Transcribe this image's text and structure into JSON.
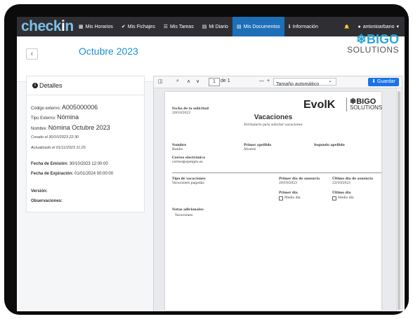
{
  "brand": {
    "logo_main": "check",
    "logo_accent": "i",
    "logo_tail": "n"
  },
  "nav": {
    "items": [
      {
        "label": "Mis Horarios",
        "icon": "calendar-icon",
        "glyph": "▦"
      },
      {
        "label": "Mis Fichajes",
        "icon": "check-icon",
        "glyph": "✔"
      },
      {
        "label": "Mis Tareas",
        "icon": "list-icon",
        "glyph": "☰"
      },
      {
        "label": "Mi Diario",
        "icon": "book-icon",
        "glyph": "▤"
      },
      {
        "label": "Mis Documentos",
        "icon": "document-icon",
        "glyph": "▤"
      },
      {
        "label": "Información",
        "icon": "info-icon",
        "glyph": "ℹ"
      }
    ],
    "active_index": 4,
    "bell_glyph": "🔔",
    "user_glyph": "●",
    "user": "antonioarbano",
    "user_caret": "▾"
  },
  "header": {
    "back": "‹",
    "title": "Octubre 2023",
    "company_logo_top": "BIGO",
    "company_logo_bottom": "SOLUTIONS"
  },
  "details": {
    "heading": "Detalles",
    "info_glyph": "i",
    "codigo_label": "Código externo:",
    "codigo_value": "A005000006",
    "tipo_label": "Tipo Externo:",
    "tipo_value": "Nómina",
    "nombre_label": "Nombre:",
    "nombre_value": "Nómina Octubre 2023",
    "creado": "Creado el 30/10/2023 22:30",
    "actualizado": "Actualizado el 01/11/2023 11:25",
    "emision_label": "Fecha de Emisión:",
    "emision_value": "30/10/2023 12:00:00",
    "expiracion_label": "Fecha de Expiración:",
    "expiracion_value": "01/01/2024 00:00:00",
    "version_label": "Versión:",
    "observaciones_label": "Observaciones:"
  },
  "viewer": {
    "sidebar_glyph": "◫",
    "search_glyph": "⌕",
    "prev_glyph": "∧",
    "next_glyph": "∨",
    "page_current": "1",
    "page_total": "de 1",
    "zoom_out": "—",
    "zoom_in": "+",
    "zoom_value": "Tamaño automático",
    "zoom_caret": "⌄",
    "save_label": "⬇ Guardar"
  },
  "document": {
    "brand_left": "EvolK",
    "brand_right_top": "BIGO",
    "brand_right_bottom": "SOLUTIONS",
    "fecha_label": "Fecha de la solicitud",
    "fecha_value": "20/10/2023",
    "title": "Vacaciones",
    "subtitle": "Formulario para solicitar vacaciones",
    "nombre_label": "Nombre",
    "nombre_value": "Basilio",
    "apellido1_label": "Primer apellido",
    "apellido1_value": "Álvarez",
    "apellido2_label": "Segundo apellido",
    "email_label": "Correo electrónico",
    "email_value": "correo@ejemplo.es",
    "tipo_label": "Tipo de vacaciones",
    "tipo_value": "Vacaciones pagadas",
    "primer_ausencia_label": "Primer día de ausencia",
    "primer_ausencia_value": "20/10/2023",
    "ultimo_ausencia_label": "Último día de ausencia",
    "ultimo_ausencia_value": "22/10/2023",
    "primer_dia_label": "Primer día",
    "ultimo_dia_label": "Último día",
    "medio_dia_1": "Medio día",
    "medio_dia_2": "Medio día",
    "notas_label": "Notas adicionales",
    "notas_value": "Vacaciones"
  }
}
